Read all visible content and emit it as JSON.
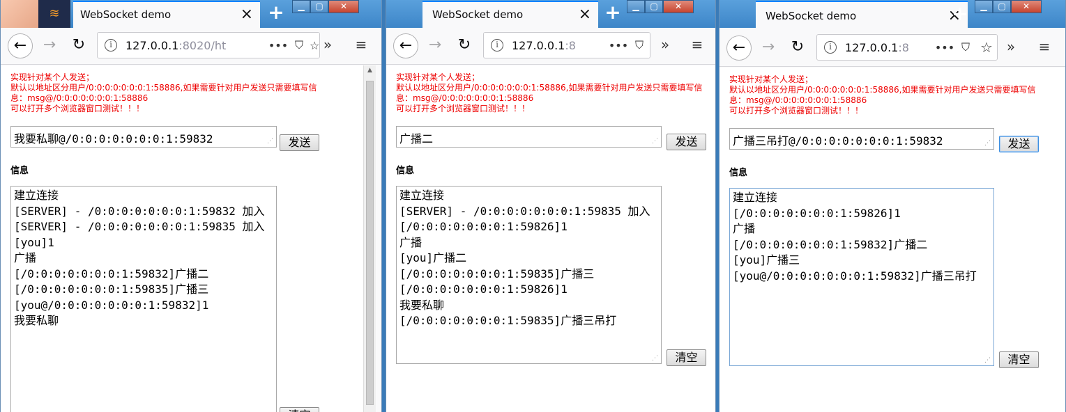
{
  "windows": [
    {
      "tab_title": "WebSocket demo",
      "url_host": "127.0.0.1",
      "url_rest": ":8020/ht",
      "notice": "实现针对某个人发送；\n默认以地址区分用户/0:0:0:0:0:0:0:1:58886,如果需要针对用户发送只需要填写信\n息：msg@/0:0:0:0:0:0:0:1:58886\n可以打开多个浏览器窗口测试！！！",
      "input_value": "我要私聊@/0:0:0:0:0:0:0:1:59832",
      "send_label": "发送",
      "info_label": "信息",
      "clear_label": "清空",
      "log": [
        "建立连接",
        "[SERVER] - /0:0:0:0:0:0:0:1:59832 加入",
        "[SERVER] - /0:0:0:0:0:0:0:1:59835 加入",
        "[you]1",
        "广播",
        "[/0:0:0:0:0:0:0:1:59832]广播二",
        "[/0:0:0:0:0:0:0:1:59835]广播三",
        "[you@/0:0:0:0:0:0:0:1:59832]1",
        "我要私聊"
      ]
    },
    {
      "tab_title": "WebSocket demo",
      "url_host": "127.0.0.1",
      "url_rest": ":8",
      "notice": "实现针对某个人发送；\n默认以地址区分用户/0:0:0:0:0:0:0:1:58886,如果需要针对用户发送只需要填写信\n息：msg@/0:0:0:0:0:0:0:1:58886\n可以打开多个浏览器窗口测试！！！",
      "input_value": "广播二",
      "send_label": "发送",
      "info_label": "信息",
      "clear_label": "清空",
      "log": [
        "建立连接",
        "[SERVER] - /0:0:0:0:0:0:0:1:59835 加入",
        "[/0:0:0:0:0:0:0:1:59826]1",
        "广播",
        "[you]广播二",
        "[/0:0:0:0:0:0:0:1:59835]广播三",
        "[/0:0:0:0:0:0:0:1:59826]1",
        "我要私聊",
        "[/0:0:0:0:0:0:0:1:59835]广播三吊打"
      ]
    },
    {
      "tab_title": "WebSocket demo",
      "url_host": "127.0.0.1",
      "url_rest": ":8",
      "notice": "实现针对某个人发送；\n默认以地址区分用户/0:0:0:0:0:0:0:1:58886,如果需要针对用户发送只需要填写信\n息：msg@/0:0:0:0:0:0:0:1:58886\n可以打开多个浏览器窗口测试！！！",
      "input_value": "广播三吊打@/0:0:0:0:0:0:0:1:59832",
      "send_label": "发送",
      "info_label": "信息",
      "clear_label": "清空",
      "log": [
        "建立连接",
        "[/0:0:0:0:0:0:0:1:59826]1",
        "广播",
        "[/0:0:0:0:0:0:0:1:59832]广播二",
        "[you]广播三",
        "[you@/0:0:0:0:0:0:0:1:59832]广播三吊打"
      ]
    }
  ],
  "icons": {
    "close": "×",
    "new_tab": "+",
    "back": "←",
    "forward": "→",
    "reload": "↻",
    "info": "i",
    "more": "•••",
    "pocket": "⛉",
    "star": "☆",
    "overflow": "»",
    "menu": "≡"
  },
  "colors": {
    "notice": "#ee0000",
    "accent": "#0a84ff",
    "titlebar": "#3d86c8"
  }
}
